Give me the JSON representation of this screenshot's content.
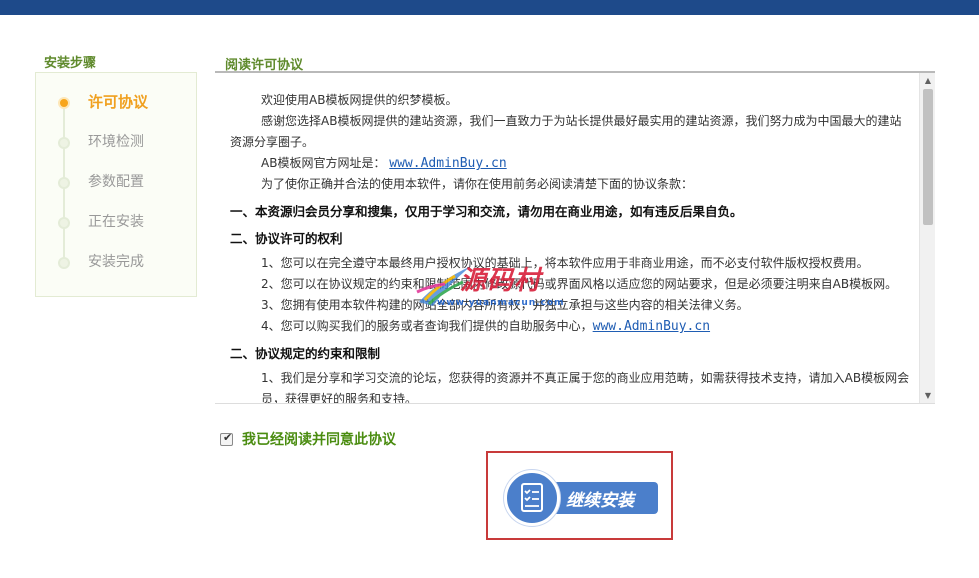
{
  "steps": {
    "title": "安装步骤",
    "items": [
      {
        "label": "许可协议",
        "active": true
      },
      {
        "label": "环境检测",
        "active": false
      },
      {
        "label": "参数配置",
        "active": false
      },
      {
        "label": "正在安装",
        "active": false
      },
      {
        "label": "安装完成",
        "active": false
      }
    ]
  },
  "panel": {
    "title": "阅读许可协议"
  },
  "license": {
    "p1": "欢迎使用AB模板网提供的织梦模板。",
    "p2": "感谢您选择AB模板网提供的建站资源，我们一直致力于为站长提供最好最实用的建站资源，我们努力成为中国最大的建站资源分享圈子。",
    "p3_prefix": "AB模板网官方网址是：",
    "p3_link": "www.AdminBuy.cn",
    "p4": "为了使你正确并合法的使用本软件，请你在使用前务必阅读清楚下面的协议条款：",
    "h1": "一、本资源归会员分享和搜集，仅用于学习和交流，请勿用在商业用途，如有违反后果自负。",
    "h2": "二、协议许可的权利",
    "h2_items": [
      "1、您可以在完全遵守本最终用户授权协议的基础上，将本软件应用于非商业用途，而不必支付软件版权授权费用。",
      "2、您可以在协议规定的约束和限制范围内修改源代码或界面风格以适应您的网站要求，但是必须要注明来自AB模板网。",
      "3、您拥有使用本软件构建的网站全部内容所有权，并独立承担与这些内容的相关法律义务。"
    ],
    "h2_item4_prefix": "4、您可以购买我们的服务或者查询我们提供的自助服务中心，",
    "h2_item4_link": "www.AdminBuy.cn",
    "h3": "二、协议规定的约束和限制",
    "h3_items": [
      "1、我们是分享和学习交流的论坛，您获得的资源并不真正属于您的商业应用范畴，如需获得技术支持，请加入AB模板网会员，获得更好的服务和支持。"
    ]
  },
  "agree": {
    "label": "我已经阅读并同意此协议",
    "checked": true
  },
  "continue_button": {
    "label": "继续安装"
  },
  "watermark": {
    "title": "源码村",
    "url": "www.yuanmacun.com"
  },
  "colors": {
    "topbar": "#1e4a8a",
    "step_active": "#f0a01f",
    "title_green": "#5f8a2c",
    "agree_green": "#4a8c10",
    "button_blue": "#4b7fcb",
    "frame_red": "#c83a3a"
  }
}
